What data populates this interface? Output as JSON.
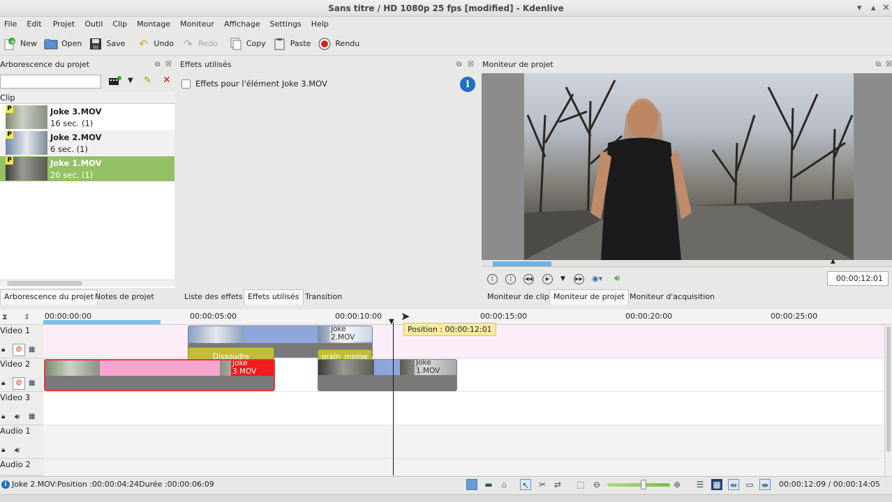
{
  "window": {
    "title": "Sans titre / HD 1080p 25 fps [modified] - Kdenlive"
  },
  "menu": [
    "File",
    "Edit",
    "Projet",
    "Outil",
    "Clip",
    "Montage",
    "Moniteur",
    "Affichage",
    "Settings",
    "Help"
  ],
  "toolbar": {
    "new": "New",
    "open": "Open",
    "save": "Save",
    "undo": "Undo",
    "redo": "Redo",
    "copy": "Copy",
    "paste": "Paste",
    "render": "Rendu"
  },
  "project_tree": {
    "title": "Arborescence du projet",
    "column_header": "Clip",
    "clips": [
      {
        "name": "Joke 3.MOV",
        "duration": "16 sec. (1)",
        "badge": "P"
      },
      {
        "name": "Joke 2.MOV",
        "duration": "6 sec. (1)",
        "badge": "P"
      },
      {
        "name": "Joke 1.MOV",
        "duration": "20 sec. (1)",
        "badge": "P",
        "selected": true
      }
    ],
    "tabs": [
      "Arborescence du projet",
      "Notes de projet"
    ]
  },
  "effects": {
    "title": "Effets utilisés",
    "checkbox_label": "Effets pour l'élément Joke 3.MOV",
    "tabs": [
      "Liste des effets",
      "Effets utilisés",
      "Transition"
    ]
  },
  "monitor": {
    "title": "Moniteur de projet",
    "timecode": "00:00:12:01",
    "tabs": [
      "Moniteur de clip",
      "Moniteur de projet",
      "Moniteur d'acquisition"
    ]
  },
  "timeline": {
    "ruler": [
      "00:00:00:00",
      "00:00:05:00",
      "00:00:10:00",
      "00:00:15:00",
      "00:00:20:00",
      "00:00:25:00"
    ],
    "position_tooltip": "Position : 00:00:12:01",
    "tracks": [
      "Video 1",
      "Video 2",
      "Video 3",
      "Audio 1",
      "Audio 2"
    ],
    "clips": {
      "v1_clip_a": "Joke 2.MOV",
      "v1_transition": "Dissoudre",
      "v1_effect": "grain_merge",
      "v2_clip_a": "Joke 3.MOV",
      "v2_clip_b": "Joke 1.MOV"
    }
  },
  "statusbar": {
    "message": "Joke 2.MOV:Position :00:00:04:24Durée :00:00:06:09",
    "timecode": "00:00:12:09 / 00:00:14:05"
  },
  "colors": {
    "selection_green": "#95c166",
    "track_pink": "#fbeef8",
    "clip_blue": "#8ea6dc",
    "clip_pink": "#f7a5cf",
    "effect_olive": "#bfbe3c",
    "label_red": "#ee1c1c"
  }
}
